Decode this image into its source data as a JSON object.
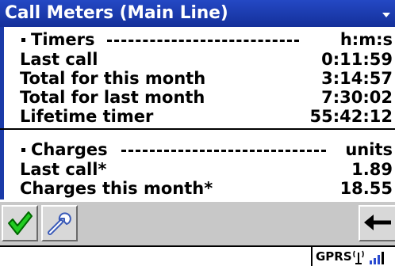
{
  "window": {
    "title": "Call Meters (Main Line)"
  },
  "timers": {
    "header": "Timers",
    "unit": "h:m:s",
    "rows": [
      {
        "label": "Last call",
        "value": "0:11:59"
      },
      {
        "label": "Total for this month",
        "value": "3:14:57"
      },
      {
        "label": "Total for last month",
        "value": "7:30:02"
      },
      {
        "label": "Lifetime timer",
        "value": "55:42:12"
      }
    ]
  },
  "charges": {
    "header": "Charges",
    "unit": "units",
    "rows": [
      {
        "label": "Last call*",
        "value": "1.89"
      },
      {
        "label": "Charges this month*",
        "value": "18.55"
      }
    ]
  },
  "toolbar": {
    "icons": [
      "checkmark-icon",
      "wrench-icon",
      "back-arrow-icon"
    ]
  },
  "status": {
    "network": "GPRS",
    "icons": [
      "signal-strength-icon"
    ]
  },
  "colors": {
    "titlebar": "#1a3aa8",
    "toolbar": "#c8c8c8",
    "checkmark": "#22cc22"
  }
}
